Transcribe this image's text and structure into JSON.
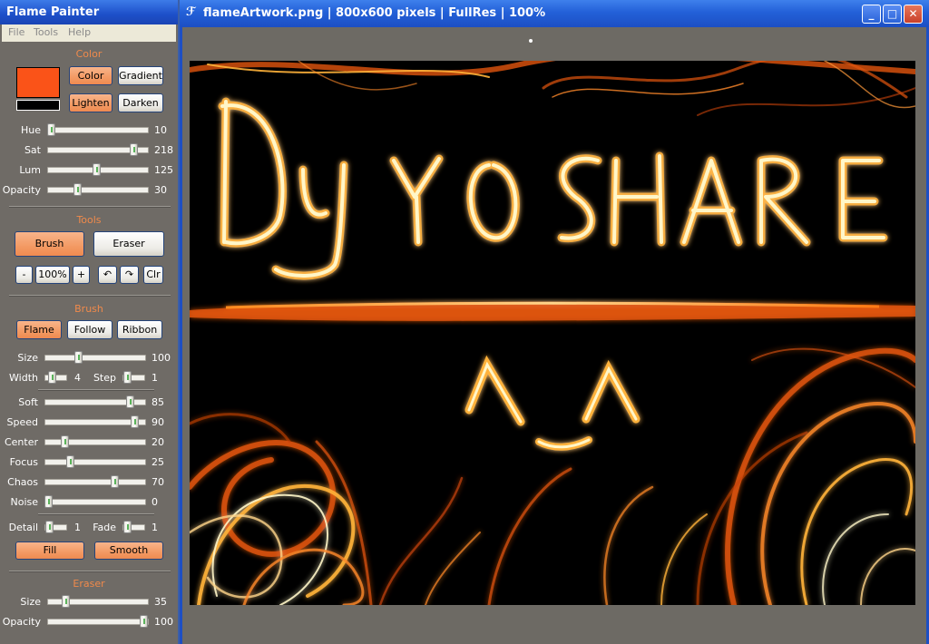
{
  "panel": {
    "title": "Flame Painter",
    "menu": [
      "File",
      "Tools",
      "Help"
    ],
    "color": {
      "section_label": "Color",
      "foreground": "#fa5318",
      "background": "#000000",
      "buttons": {
        "color": "Color",
        "gradient": "Gradient",
        "lighten": "Lighten",
        "darken": "Darken"
      },
      "hue": {
        "label": "Hue",
        "value": "10",
        "fraction": 0.04
      },
      "sat": {
        "label": "Sat",
        "value": "218",
        "fraction": 0.86
      },
      "lum": {
        "label": "Lum",
        "value": "125",
        "fraction": 0.49
      },
      "opacity": {
        "label": "Opacity",
        "value": "30",
        "fraction": 0.3
      }
    },
    "tools": {
      "section_label": "Tools",
      "brush": "Brush",
      "eraser": "Eraser",
      "zoom_out": "-",
      "zoom": "100%",
      "zoom_in": "+",
      "clear": "Clr"
    },
    "brush": {
      "section_label": "Brush",
      "modes": {
        "flame": "Flame",
        "follow": "Follow",
        "ribbon": "Ribbon"
      },
      "size": {
        "label": "Size",
        "value": "100",
        "fraction": 0.34
      },
      "width": {
        "label": "Width",
        "value": "4",
        "fraction": 0.35
      },
      "step": {
        "label": "Step",
        "value": "1",
        "fraction": 0.2
      },
      "soft": {
        "label": "Soft",
        "value": "85",
        "fraction": 0.85
      },
      "speed": {
        "label": "Speed",
        "value": "90",
        "fraction": 0.9
      },
      "center": {
        "label": "Center",
        "value": "20",
        "fraction": 0.2
      },
      "focus": {
        "label": "Focus",
        "value": "25",
        "fraction": 0.25
      },
      "chaos": {
        "label": "Chaos",
        "value": "70",
        "fraction": 0.7
      },
      "noise": {
        "label": "Noise",
        "value": "0",
        "fraction": 0.0
      },
      "detail": {
        "label": "Detail",
        "value": "1",
        "fraction": 0.2
      },
      "fade": {
        "label": "Fade",
        "value": "1",
        "fraction": 0.2
      },
      "fill": "Fill",
      "smooth": "Smooth"
    },
    "eraser": {
      "section_label": "Eraser",
      "size": {
        "label": "Size",
        "value": "35",
        "fraction": 0.18
      },
      "opacity": {
        "label": "Opacity",
        "value": "100",
        "fraction": 1.0
      }
    }
  },
  "document": {
    "title": "flameArtwork.png  |  800x600 pixels  |  FullRes  |  100%",
    "artwork_text": "DyYOSHARE",
    "colors": {
      "flame_core": "#fff6c8",
      "flame_mid": "#ffb23a",
      "flame_outer": "#e2550e",
      "canvas": "#000000",
      "title_bar": "#2360d8"
    }
  }
}
